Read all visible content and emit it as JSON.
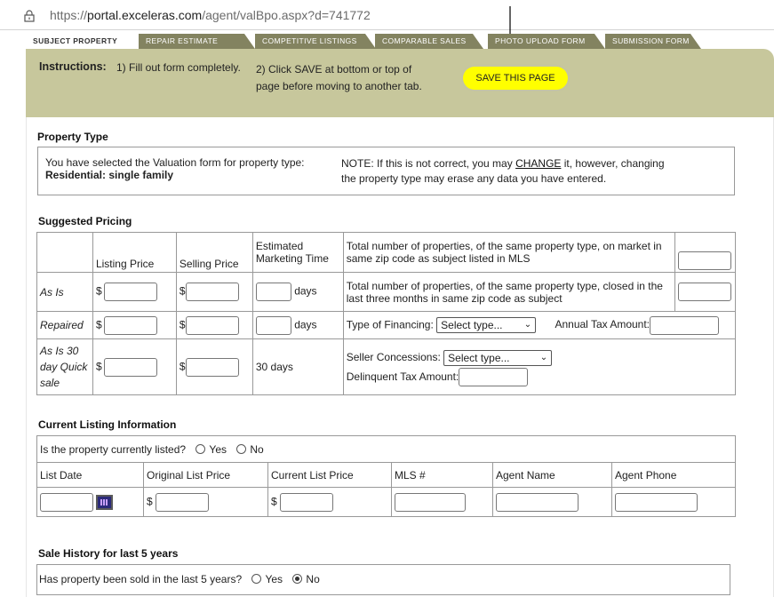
{
  "browser": {
    "url_prefix": "https://",
    "url_domain": "portal.exceleras.com",
    "url_path": "/agent/valBpo.aspx?d=741772"
  },
  "tabs": [
    {
      "label": "Subject Property",
      "active": true
    },
    {
      "label": "Repair Estimate",
      "active": false
    },
    {
      "label": "Competitive Listings",
      "active": false
    },
    {
      "label": "Comparable Sales",
      "active": false
    },
    {
      "label": "Photo Upload Form",
      "active": false
    },
    {
      "label": "Submission Form",
      "active": false
    }
  ],
  "instructions": {
    "title": "Instructions:",
    "step1": "1) Fill out form completely.",
    "step2": "2) Click SAVE at bottom or top of page before moving to another tab.",
    "save_label": "SAVE THIS PAGE"
  },
  "property_type": {
    "title": "Property Type",
    "selected_text": "You have selected the Valuation form for property type:",
    "selected_value": "Residential: single family",
    "note_before": "NOTE: If this is not correct, you may",
    "change_link": "CHANGE",
    "note_after": "it, however, changing the property type may erase any data you have entered."
  },
  "pricing": {
    "title": "Suggested Pricing",
    "headers": [
      "Listing Price",
      "Selling Price",
      "Estimated Marketing Time"
    ],
    "rows": [
      {
        "label": "As Is",
        "time_suffix": "days"
      },
      {
        "label": "Repaired",
        "time_suffix": "days"
      },
      {
        "label": "As Is 30 day Quick sale",
        "time_text": "30 days"
      }
    ],
    "currency": "$",
    "on_market_text": "Total number of properties, of the same property type, on market in same zip code as subject listed in MLS",
    "closed_text": "Total number of properties, of the same property type, closed in the last three months in same zip code as subject",
    "financing_label": "Type of Financing:",
    "financing_value": "Select type...",
    "tax_label": "Annual Tax Amount:",
    "concessions_label": "Seller Concessions:",
    "concessions_value": "Select type...",
    "delinquent_label": "Delinquent Tax Amount:"
  },
  "listing": {
    "title": "Current Listing Information",
    "question": "Is the property currently listed?",
    "yes": "Yes",
    "no": "No",
    "columns": [
      "List Date",
      "Original List Price",
      "Current List Price",
      "MLS #",
      "Agent Name",
      "Agent Phone"
    ],
    "currency": "$"
  },
  "sale_history": {
    "title": "Sale History for last 5 years",
    "question": "Has property been sold in the last 5 years?",
    "yes": "Yes",
    "no": "No",
    "selected": "No"
  },
  "colors": {
    "tab_bg": "#838360",
    "instructions_bg": "#c7c79c",
    "save_button": "#ffff00",
    "calendar": "#2c2a7a"
  }
}
